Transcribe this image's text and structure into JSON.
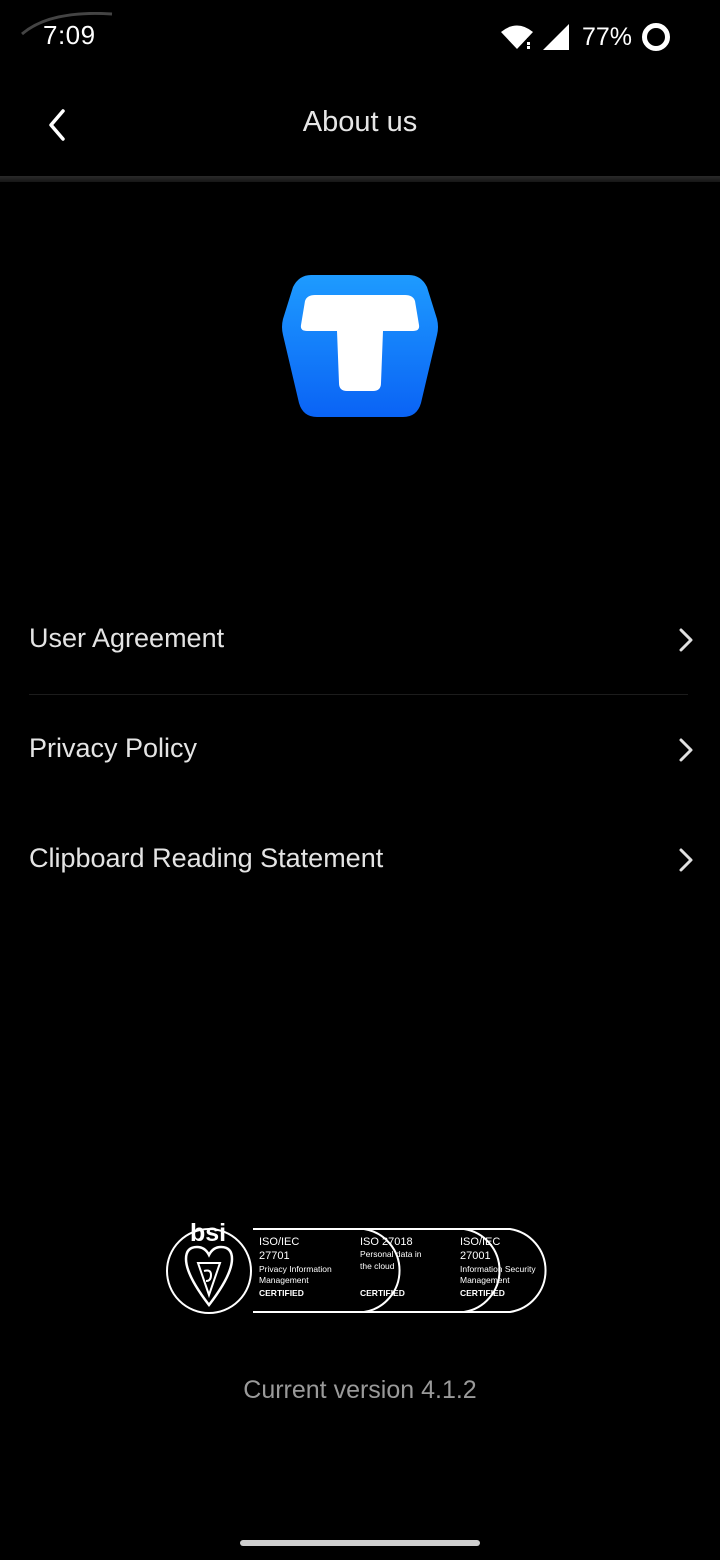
{
  "status_bar": {
    "time": "7:09",
    "battery_percent": "77%",
    "icons": [
      "wifi-icon",
      "signal-icon",
      "battery-ring-icon"
    ]
  },
  "header": {
    "title": "About us",
    "back_icon": "chevron-left-icon"
  },
  "logo": {
    "icon": "app-logo-icon",
    "brand_colors": [
      "#1e9bff",
      "#0a63f5"
    ]
  },
  "menu": {
    "items": [
      {
        "label": "User Agreement",
        "icon": "chevron-right-icon"
      },
      {
        "label": "Privacy Policy",
        "icon": "chevron-right-icon"
      },
      {
        "label": "Clipboard Reading Statement",
        "icon": "chevron-right-icon"
      }
    ]
  },
  "certifications": {
    "brand": "bsi",
    "badges": [
      {
        "standard": "ISO/IEC",
        "number": "27701",
        "desc_1": "Privacy Information",
        "desc_2": "Management",
        "status": "CERTIFIED"
      },
      {
        "standard": "ISO 27018",
        "number": "",
        "desc_1": "Personal data in",
        "desc_2": "the cloud",
        "status": "CERTIFIED"
      },
      {
        "standard": "ISO/IEC",
        "number": "27001",
        "desc_1": "Information Security",
        "desc_2": "Management",
        "status": "CERTIFIED"
      }
    ]
  },
  "footer": {
    "version": "Current version 4.1.2"
  }
}
